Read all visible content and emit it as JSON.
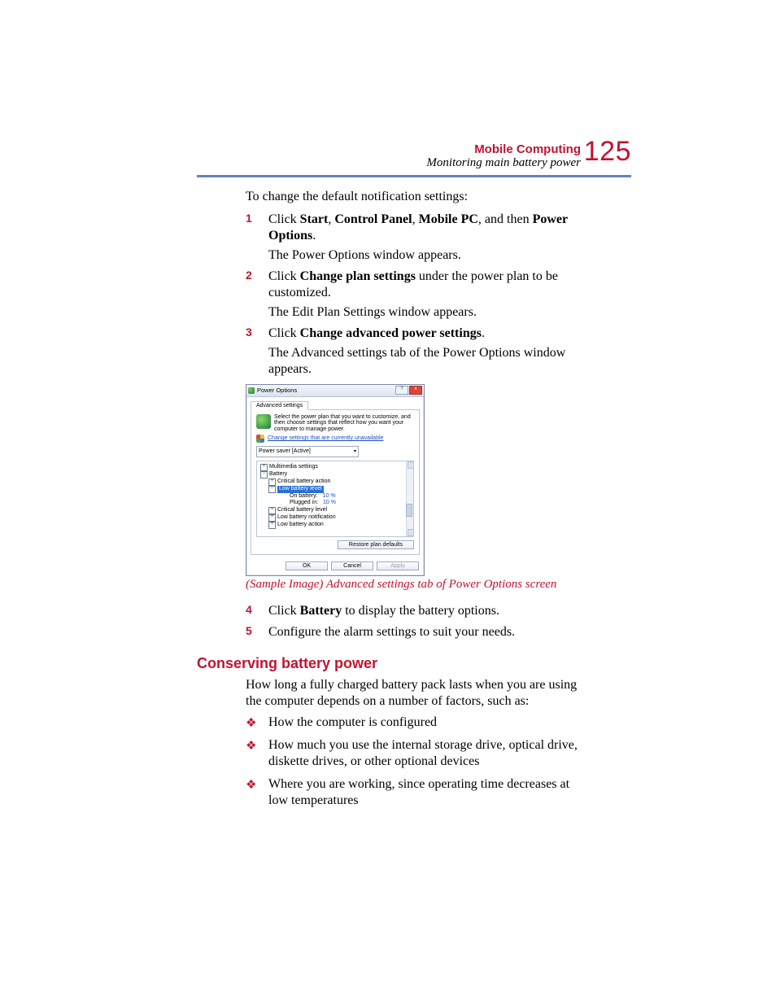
{
  "header": {
    "chapter": "Mobile Computing",
    "section": "Monitoring main battery power",
    "page_number": "125"
  },
  "intro": "To change the default notification settings:",
  "steps_a": [
    {
      "n": "1",
      "parts": [
        {
          "t": "Click ",
          "b": false
        },
        {
          "t": "Start",
          "b": true
        },
        {
          "t": ", ",
          "b": false
        },
        {
          "t": "Control Panel",
          "b": true
        },
        {
          "t": ", ",
          "b": false
        },
        {
          "t": "Mobile PC",
          "b": true
        },
        {
          "t": ", and then ",
          "b": false
        },
        {
          "t": "Power Options",
          "b": true
        },
        {
          "t": ".",
          "b": false
        }
      ],
      "sub": "The Power Options window appears."
    },
    {
      "n": "2",
      "parts": [
        {
          "t": "Click ",
          "b": false
        },
        {
          "t": "Change plan settings",
          "b": true
        },
        {
          "t": " under the power plan to be customized.",
          "b": false
        }
      ],
      "sub": "The Edit Plan Settings window appears."
    },
    {
      "n": "3",
      "parts": [
        {
          "t": "Click ",
          "b": false
        },
        {
          "t": "Change advanced power settings",
          "b": true
        },
        {
          "t": ".",
          "b": false
        }
      ],
      "sub": "The Advanced settings tab of the Power Options window appears."
    }
  ],
  "dialog": {
    "title": "Power Options",
    "tab": "Advanced settings",
    "description": "Select the power plan that you want to customize, and then choose settings that reflect how you want your computer to manage power.",
    "link": "Change settings that are currently unavailable",
    "plan_selected": "Power saver [Active]",
    "tree": {
      "multimedia": "Multimedia settings",
      "battery": "Battery",
      "critical_action": "Critical battery action",
      "low_level": "Low battery level",
      "on_battery_label": "On battery:",
      "on_battery_value": "10 %",
      "plugged_label": "Plugged in:",
      "plugged_value": "10 %",
      "critical_level": "Critical battery level",
      "low_notif": "Low battery notification",
      "low_action": "Low battery action"
    },
    "restore": "Restore plan defaults",
    "ok": "OK",
    "cancel": "Cancel",
    "apply": "Apply"
  },
  "figure_caption": "(Sample Image) Advanced settings tab of Power Options screen",
  "steps_b": [
    {
      "n": "4",
      "parts": [
        {
          "t": "Click ",
          "b": false
        },
        {
          "t": "Battery",
          "b": true
        },
        {
          "t": " to display the battery options.",
          "b": false
        }
      ]
    },
    {
      "n": "5",
      "parts": [
        {
          "t": "Configure the alarm settings to suit your needs.",
          "b": false
        }
      ]
    }
  ],
  "h2": "Conserving battery power",
  "p_after_h2": "How long a fully charged battery pack lasts when you are using the computer depends on a number of factors, such as:",
  "bullets": [
    "How the computer is configured",
    "How much you use the internal storage drive, optical drive, diskette drives, or other optional devices",
    "Where you are working, since operating time decreases at low temperatures"
  ]
}
